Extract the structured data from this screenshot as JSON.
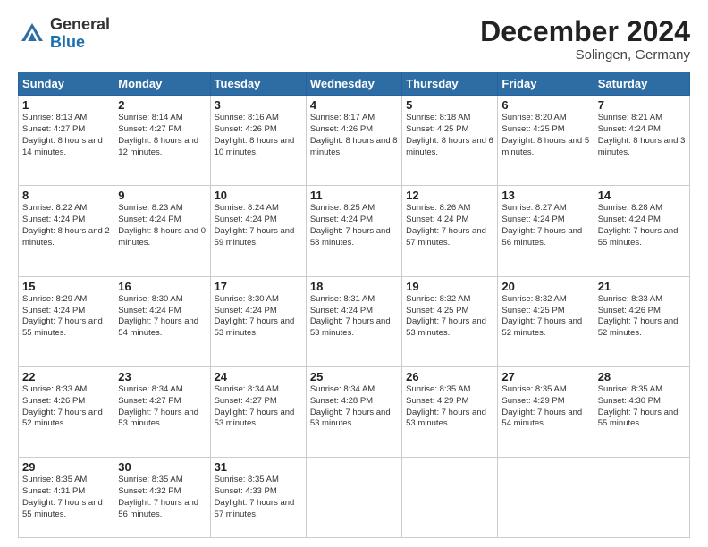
{
  "header": {
    "logo_general": "General",
    "logo_blue": "Blue",
    "month_title": "December 2024",
    "location": "Solingen, Germany"
  },
  "days_of_week": [
    "Sunday",
    "Monday",
    "Tuesday",
    "Wednesday",
    "Thursday",
    "Friday",
    "Saturday"
  ],
  "weeks": [
    [
      {
        "day": 1,
        "sunrise": "8:13 AM",
        "sunset": "4:27 PM",
        "daylight": "8 hours and 14 minutes"
      },
      {
        "day": 2,
        "sunrise": "8:14 AM",
        "sunset": "4:27 PM",
        "daylight": "8 hours and 12 minutes"
      },
      {
        "day": 3,
        "sunrise": "8:16 AM",
        "sunset": "4:26 PM",
        "daylight": "8 hours and 10 minutes"
      },
      {
        "day": 4,
        "sunrise": "8:17 AM",
        "sunset": "4:26 PM",
        "daylight": "8 hours and 8 minutes"
      },
      {
        "day": 5,
        "sunrise": "8:18 AM",
        "sunset": "4:25 PM",
        "daylight": "8 hours and 6 minutes"
      },
      {
        "day": 6,
        "sunrise": "8:20 AM",
        "sunset": "4:25 PM",
        "daylight": "8 hours and 5 minutes"
      },
      {
        "day": 7,
        "sunrise": "8:21 AM",
        "sunset": "4:24 PM",
        "daylight": "8 hours and 3 minutes"
      }
    ],
    [
      {
        "day": 8,
        "sunrise": "8:22 AM",
        "sunset": "4:24 PM",
        "daylight": "8 hours and 2 minutes"
      },
      {
        "day": 9,
        "sunrise": "8:23 AM",
        "sunset": "4:24 PM",
        "daylight": "8 hours and 0 minutes"
      },
      {
        "day": 10,
        "sunrise": "8:24 AM",
        "sunset": "4:24 PM",
        "daylight": "7 hours and 59 minutes"
      },
      {
        "day": 11,
        "sunrise": "8:25 AM",
        "sunset": "4:24 PM",
        "daylight": "7 hours and 58 minutes"
      },
      {
        "day": 12,
        "sunrise": "8:26 AM",
        "sunset": "4:24 PM",
        "daylight": "7 hours and 57 minutes"
      },
      {
        "day": 13,
        "sunrise": "8:27 AM",
        "sunset": "4:24 PM",
        "daylight": "7 hours and 56 minutes"
      },
      {
        "day": 14,
        "sunrise": "8:28 AM",
        "sunset": "4:24 PM",
        "daylight": "7 hours and 55 minutes"
      }
    ],
    [
      {
        "day": 15,
        "sunrise": "8:29 AM",
        "sunset": "4:24 PM",
        "daylight": "7 hours and 55 minutes"
      },
      {
        "day": 16,
        "sunrise": "8:30 AM",
        "sunset": "4:24 PM",
        "daylight": "7 hours and 54 minutes"
      },
      {
        "day": 17,
        "sunrise": "8:30 AM",
        "sunset": "4:24 PM",
        "daylight": "7 hours and 53 minutes"
      },
      {
        "day": 18,
        "sunrise": "8:31 AM",
        "sunset": "4:24 PM",
        "daylight": "7 hours and 53 minutes"
      },
      {
        "day": 19,
        "sunrise": "8:32 AM",
        "sunset": "4:25 PM",
        "daylight": "7 hours and 53 minutes"
      },
      {
        "day": 20,
        "sunrise": "8:32 AM",
        "sunset": "4:25 PM",
        "daylight": "7 hours and 52 minutes"
      },
      {
        "day": 21,
        "sunrise": "8:33 AM",
        "sunset": "4:26 PM",
        "daylight": "7 hours and 52 minutes"
      }
    ],
    [
      {
        "day": 22,
        "sunrise": "8:33 AM",
        "sunset": "4:26 PM",
        "daylight": "7 hours and 52 minutes"
      },
      {
        "day": 23,
        "sunrise": "8:34 AM",
        "sunset": "4:27 PM",
        "daylight": "7 hours and 53 minutes"
      },
      {
        "day": 24,
        "sunrise": "8:34 AM",
        "sunset": "4:27 PM",
        "daylight": "7 hours and 53 minutes"
      },
      {
        "day": 25,
        "sunrise": "8:34 AM",
        "sunset": "4:28 PM",
        "daylight": "7 hours and 53 minutes"
      },
      {
        "day": 26,
        "sunrise": "8:35 AM",
        "sunset": "4:29 PM",
        "daylight": "7 hours and 53 minutes"
      },
      {
        "day": 27,
        "sunrise": "8:35 AM",
        "sunset": "4:29 PM",
        "daylight": "7 hours and 54 minutes"
      },
      {
        "day": 28,
        "sunrise": "8:35 AM",
        "sunset": "4:30 PM",
        "daylight": "7 hours and 55 minutes"
      }
    ],
    [
      {
        "day": 29,
        "sunrise": "8:35 AM",
        "sunset": "4:31 PM",
        "daylight": "7 hours and 55 minutes"
      },
      {
        "day": 30,
        "sunrise": "8:35 AM",
        "sunset": "4:32 PM",
        "daylight": "7 hours and 56 minutes"
      },
      {
        "day": 31,
        "sunrise": "8:35 AM",
        "sunset": "4:33 PM",
        "daylight": "7 hours and 57 minutes"
      },
      null,
      null,
      null,
      null
    ]
  ]
}
